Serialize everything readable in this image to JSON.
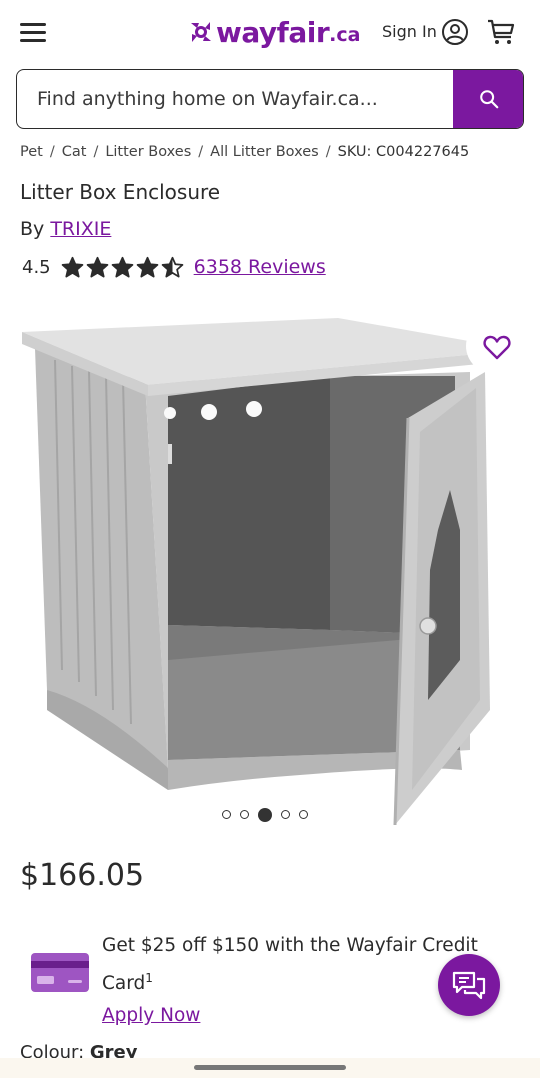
{
  "header": {
    "logo_text": "wayfair",
    "logo_tld": ".ca",
    "sign_in_label": "Sign In",
    "brand_color": "#7b189f"
  },
  "search": {
    "placeholder": "Find anything home on Wayfair.ca..."
  },
  "breadcrumb": {
    "items": [
      "Pet",
      "Cat",
      "Litter Boxes",
      "All Litter Boxes"
    ],
    "separator": "/",
    "sku": "SKU: C004227645"
  },
  "product": {
    "title": "Litter Box Enclosure",
    "by_label": "By",
    "brand": "TRIXIE",
    "rating": "4.5",
    "rating_value": 4.5,
    "rating_max": 5,
    "reviews_label": "6358 Reviews",
    "price": "$166.05",
    "carousel": {
      "count": 5,
      "active_index": 2
    },
    "colour_label": "Colour:",
    "colour_value": "Grey"
  },
  "promo": {
    "text": "Get $25 off $150 with the Wayfair Credit Card",
    "superscript": "1",
    "link_label": "Apply Now"
  },
  "icons": {
    "menu": "hamburger-menu-icon",
    "user": "user-circle-icon",
    "cart": "shopping-cart-icon",
    "search": "search-icon",
    "favorite": "heart-outline-icon",
    "chat": "chat-bubbles-icon",
    "credit": "credit-card-icon"
  }
}
